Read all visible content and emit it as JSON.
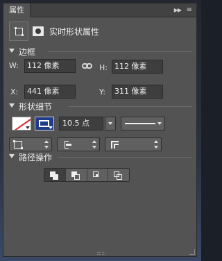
{
  "panel": {
    "tab_title": "属性",
    "collapse_icon": "double-chevron-right-icon",
    "menu_icon": "panel-menu-icon"
  },
  "header": {
    "shape_icon": "live-shape-icon",
    "mask_icon": "mask-icon",
    "title": "实时形状属性"
  },
  "transform": {
    "section_label": "边框",
    "w_label": "W:",
    "w_value": "112 像素",
    "h_label": "H:",
    "h_value": "112 像素",
    "link_icon": "link-chain-icon",
    "x_label": "X:",
    "x_value": "441 像素",
    "y_label": "Y:",
    "y_value": "311 像素"
  },
  "appearance": {
    "section_label": "形状细节",
    "fill": {
      "icon": "no-fill-swatch-icon",
      "color": "#ffffff",
      "slash_color": "#d9262b"
    },
    "stroke": {
      "icon": "stroke-swatch-icon",
      "color": "#1f3c8a"
    },
    "stroke_width": "10.5 点",
    "line_style": "solid"
  },
  "stroke_options": {
    "align_icon": "stroke-align-icon",
    "cap_icon": "stroke-cap-icon",
    "join_icon": "stroke-join-icon"
  },
  "path_ops": {
    "section_label": "路径操作",
    "buttons": [
      {
        "name": "combine-shapes",
        "icon": "combine-shapes-icon"
      },
      {
        "name": "subtract-front-shape",
        "icon": "subtract-shape-icon"
      },
      {
        "name": "intersect-shape-areas",
        "icon": "intersect-shape-icon"
      },
      {
        "name": "exclude-overlapping-shapes",
        "icon": "exclude-shape-icon"
      }
    ]
  },
  "colors": {
    "panel_bg": "#535353",
    "field_bg": "#3e3e3e",
    "text": "#e0e0e0"
  }
}
